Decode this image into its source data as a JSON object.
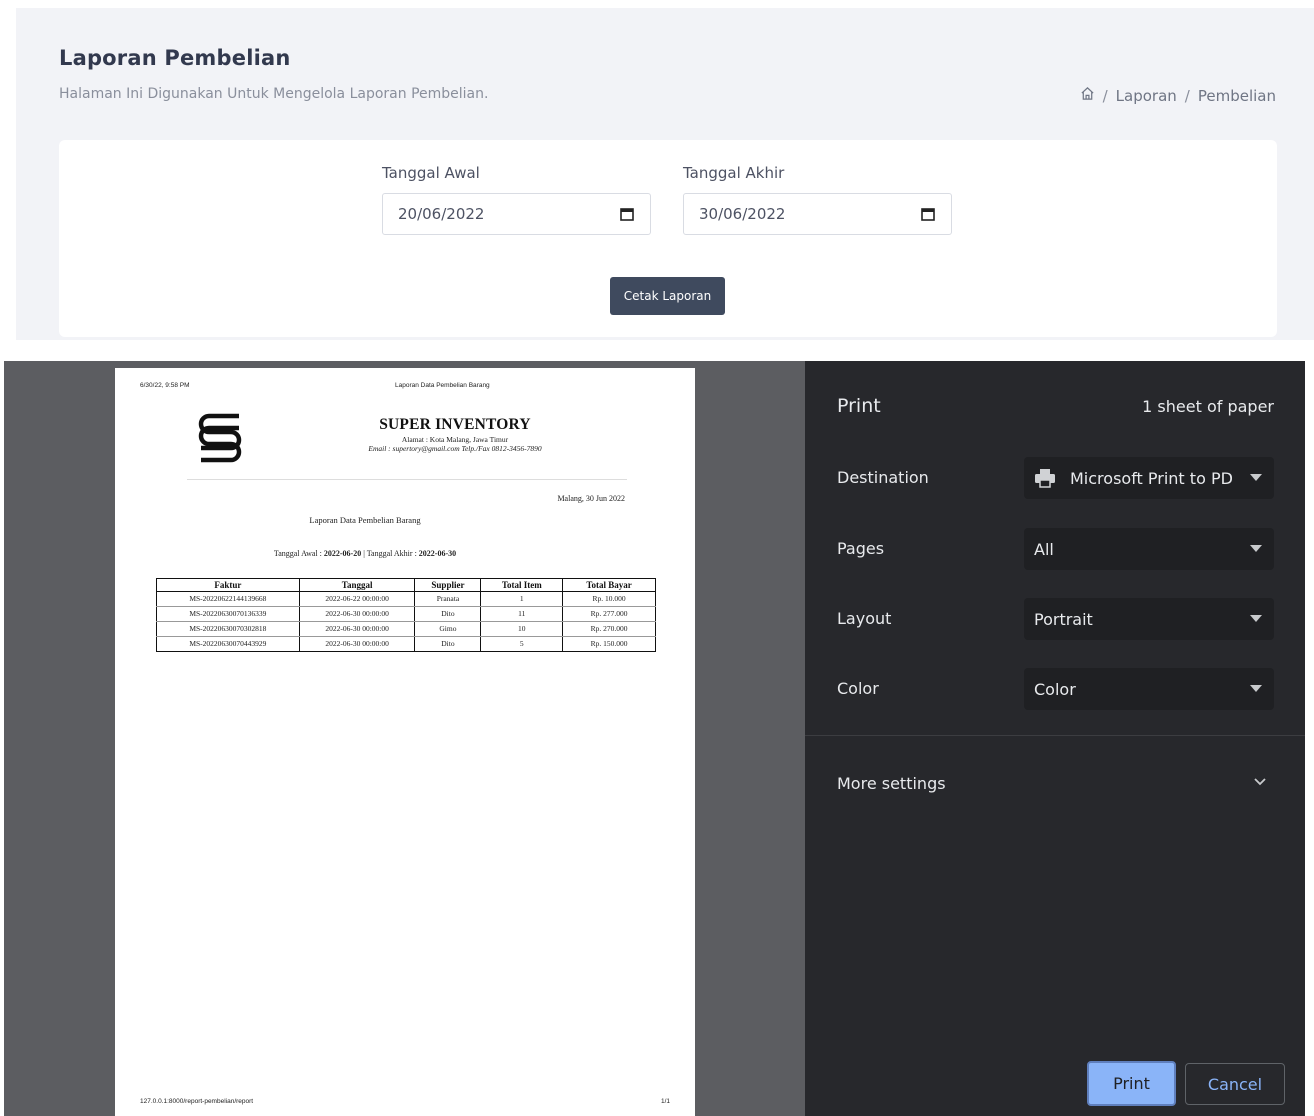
{
  "page": {
    "title": "Laporan Pembelian",
    "subtitle": "Halaman Ini Digunakan Untuk Mengelola Laporan Pembelian.",
    "breadcrumb": [
      "Laporan",
      "Pembelian"
    ]
  },
  "form": {
    "start_label": "Tanggal Awal",
    "start_value": "20/06/2022",
    "end_label": "Tanggal Akhir",
    "end_value": "30/06/2022",
    "submit_label": "Cetak Laporan"
  },
  "print_preview": {
    "header_date": "6/30/22, 9:58 PM",
    "header_title": "Laporan Data Pembelian Barang",
    "company_name": "SUPER INVENTORY",
    "company_address": "Alamat : Kota Malang, Jawa Timur",
    "company_contact": "Email : supertory@gmail.com Telp./Fax 0812-3456-7890",
    "place_date": "Malang, 30 Jun 2022",
    "report_title": "Laporan Data Pembelian Barang",
    "range_start_label": "Tanggal Awal : ",
    "range_start_value": "2022-06-20",
    "range_separator": " | ",
    "range_end_label": "Tanggal Akhir : ",
    "range_end_value": "2022-06-30",
    "table_headers": [
      "Faktur",
      "Tanggal",
      "Supplier",
      "Total Item",
      "Total Bayar"
    ],
    "table_rows": [
      [
        "MS-20220622144139668",
        "2022-06-22 00:00:00",
        "Pranata",
        "1",
        "Rp. 10.000"
      ],
      [
        "MS-20220630070136339",
        "2022-06-30 00:00:00",
        "Dito",
        "11",
        "Rp. 277.000"
      ],
      [
        "MS-20220630070302818",
        "2022-06-30 00:00:00",
        "Gimo",
        "10",
        "Rp. 270.000"
      ],
      [
        "MS-20220630070443929",
        "2022-06-30 00:00:00",
        "Dito",
        "5",
        "Rp. 150.000"
      ]
    ],
    "footer_url": "127.0.0.1:8000/report-pembelian/report",
    "footer_page": "1/1"
  },
  "print_settings": {
    "title": "Print",
    "sheets": "1 sheet of paper",
    "destination_label": "Destination",
    "destination_value": "Microsoft Print to PD",
    "pages_label": "Pages",
    "pages_value": "All",
    "layout_label": "Layout",
    "layout_value": "Portrait",
    "color_label": "Color",
    "color_value": "Color",
    "more_settings": "More settings",
    "print_button": "Print",
    "cancel_button": "Cancel"
  },
  "colors": {
    "accent": "#8ab4f8",
    "web_button": "#3f4a5e",
    "dialog_bg": "#27282c"
  },
  "icons": [
    "home-icon",
    "calendar-icon",
    "printer-icon",
    "caret-down-icon",
    "chevron-down-icon"
  ]
}
